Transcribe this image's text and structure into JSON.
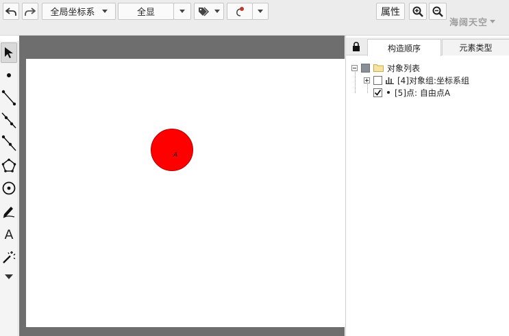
{
  "toolbar": {
    "undo_icon": "undo-icon",
    "redo_icon": "redo-icon",
    "coordinate_system": "全局坐标系",
    "view_mode": "全显",
    "properties_label": "属性",
    "zoom_in_icon": "zoom-in-icon",
    "zoom_out_icon": "zoom-out-icon",
    "brand": "海阔天空"
  },
  "tools": [
    {
      "name": "select",
      "icon": "arrow-pointer-icon",
      "selected": true
    },
    {
      "name": "point",
      "icon": "point-icon"
    },
    {
      "name": "segment",
      "icon": "segment-icon"
    },
    {
      "name": "line",
      "icon": "line-icon"
    },
    {
      "name": "ray",
      "icon": "ray-icon"
    },
    {
      "name": "polygon",
      "icon": "polygon-icon"
    },
    {
      "name": "circle",
      "icon": "circle-icon"
    },
    {
      "name": "pen",
      "icon": "pen-icon"
    },
    {
      "name": "text",
      "icon": "text-icon",
      "label": "A"
    },
    {
      "name": "magic",
      "icon": "magic-wand-icon"
    },
    {
      "name": "more",
      "icon": "caret-down-icon"
    }
  ],
  "canvas": {
    "point_label": "A",
    "point_color": "#ff0000"
  },
  "panel": {
    "tabs": [
      {
        "label": "构造顺序",
        "active": true
      },
      {
        "label": "元素类型",
        "active": false
      }
    ],
    "tree": {
      "root_label": "对象列表",
      "items": [
        {
          "label": "[4]对象组:坐标系组",
          "checked": false,
          "expandable": true,
          "icon": "chart-icon"
        },
        {
          "label": "[5]点: 自由点A",
          "checked": true,
          "expandable": false,
          "icon": "dot-icon"
        }
      ]
    }
  },
  "colors": {
    "toolbar_bg": "#ececec",
    "canvas_frame": "#6e6e6e",
    "point_fill": "#ff0000",
    "brand_text": "#9e9e9e"
  }
}
